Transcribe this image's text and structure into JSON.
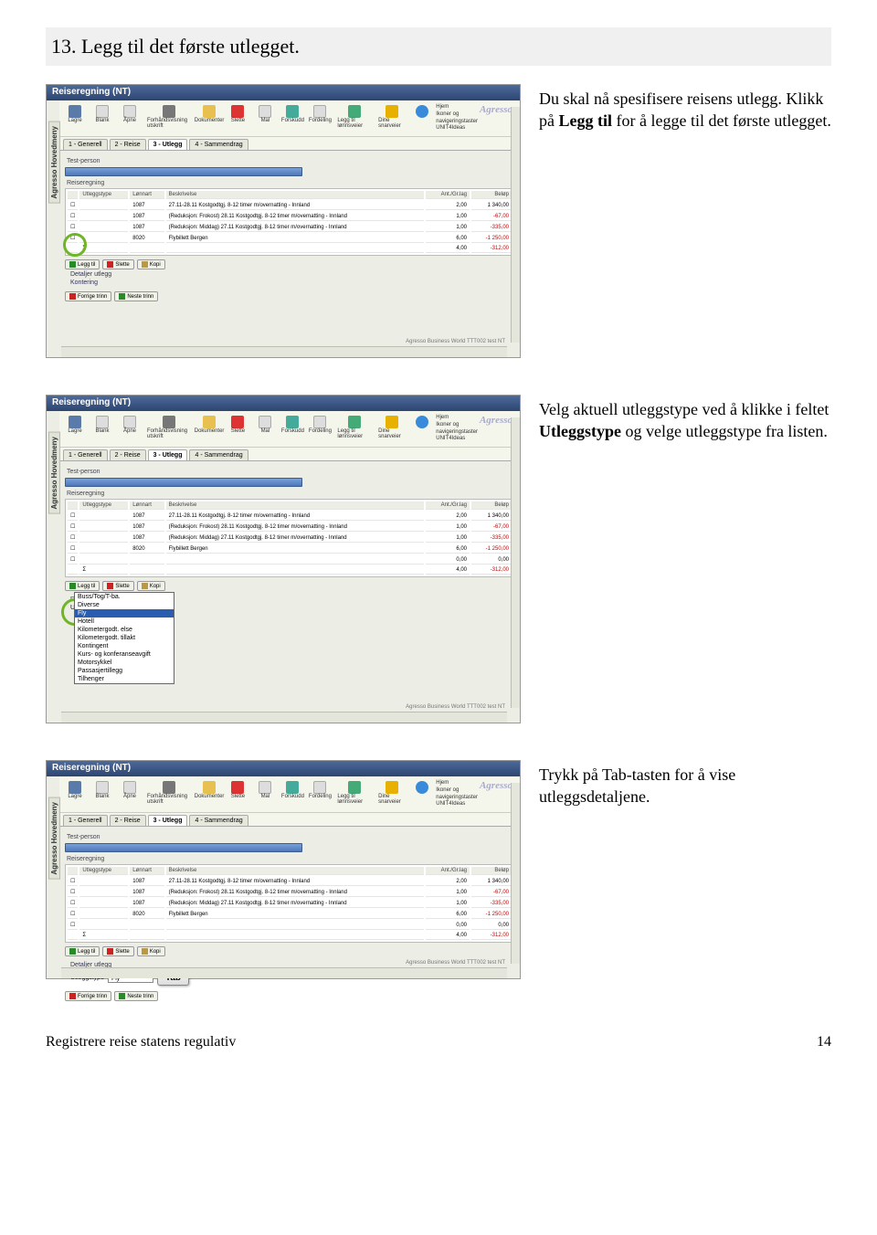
{
  "section": {
    "title": "13. Legg til det første utlegget."
  },
  "step1": {
    "text_a": "Du skal nå spesifisere reisens utlegg. Klikk på ",
    "bold": "Legg til",
    "text_b": " for å legge til det første utlegget."
  },
  "step2": {
    "text_a": "Velg aktuell utleggstype ved å klikke i feltet ",
    "bold": "Utleggstype",
    "text_b": " og velge utleggstype fra listen."
  },
  "step3": {
    "text": "Trykk på Tab-tasten for å vise utleggsdetaljene."
  },
  "window": {
    "title": "Reiseregning (NT)",
    "sidebar": "Agresso Hovedmeny",
    "logo": "Agresso",
    "status": "Agresso Business World  TTT002  test  NT"
  },
  "toolbar": {
    "lagre": "Lagre",
    "blank": "Blank",
    "apne": "Åpne",
    "forhand": "Forhåndsvisning utskrift",
    "dokumenter": "Dokumenter",
    "slette": "Slette",
    "mal": "Mal",
    "forskudd": "Forskudd",
    "fordeling": "Fordeling",
    "leggtil": "Legg til lønnsveier",
    "dine": "Dine snarveier",
    "hjelp": "Hjelp",
    "hjem": "Hjem",
    "ikoner": "Ikoner og navigeringstaster",
    "unit4": "UNIT4Ideas"
  },
  "tabs": {
    "t1": "1 - Generell",
    "t2": "2 - Reise",
    "t3": "3 - Utlegg",
    "t4": "4 - Sammendrag"
  },
  "fieldset": {
    "test_person": "Test-person",
    "reiseregning": "Reiseregning",
    "detaljer": "Detaljer utlegg",
    "kontering": "Kontering",
    "utleggstype_lbl": "Utleggstype"
  },
  "grid": {
    "h": {
      "chk": "",
      "type": "Utleggstype",
      "lonn": "Lønnart",
      "besk": "Beskrivelse",
      "ant": "Ant./Gr.lag",
      "bel": "Beløp"
    },
    "r1": {
      "lonn": "1087",
      "besk": "27.11-28.11 Kostgodtgj. 8-12 timer m/overnatting - Innland",
      "ant": "2,00",
      "bel": "1 340,00"
    },
    "r2": {
      "lonn": "1087",
      "besk": "(Reduksjon: Frokost) 28.11 Kostgodtgj. 8-12 timer m/overnatting - Innland",
      "ant": "1,00",
      "bel": "-67,00"
    },
    "r3": {
      "lonn": "1087",
      "besk": "(Reduksjon: Middag) 27.11 Kostgodtgj. 8-12 timer m/overnatting - Innland",
      "ant": "1,00",
      "bel": "-335,00"
    },
    "r4": {
      "lonn": "8020",
      "besk": "Flybillett Bergen",
      "ant": "6,00",
      "bel": "-1 250,00"
    },
    "r5": {
      "bel1": "0,00",
      "bel2": "0,00"
    },
    "sum": {
      "ant": "4,00",
      "bel": "-312,00"
    }
  },
  "btns": {
    "legg_til": "Legg til",
    "slette": "Slette",
    "kopi": "Kopi",
    "forrige": "Forrige trinn",
    "neste": "Neste trinn"
  },
  "dropdown": {
    "items": [
      "Buss/Tog/T-ba.",
      "Diverse",
      "Fly",
      "Hotell",
      "Kilometergodt. else",
      "Kilometergodt. tillakt",
      "Kontingent",
      "Kurs- og konferanseavgift",
      "Motorsykkel",
      "Passasjertillegg",
      "Tilhenger"
    ],
    "selected_index": 2
  },
  "tab_key": "Tab",
  "fly_value": "Fly",
  "footer": {
    "left": "Registrere reise statens regulativ",
    "right": "14"
  }
}
